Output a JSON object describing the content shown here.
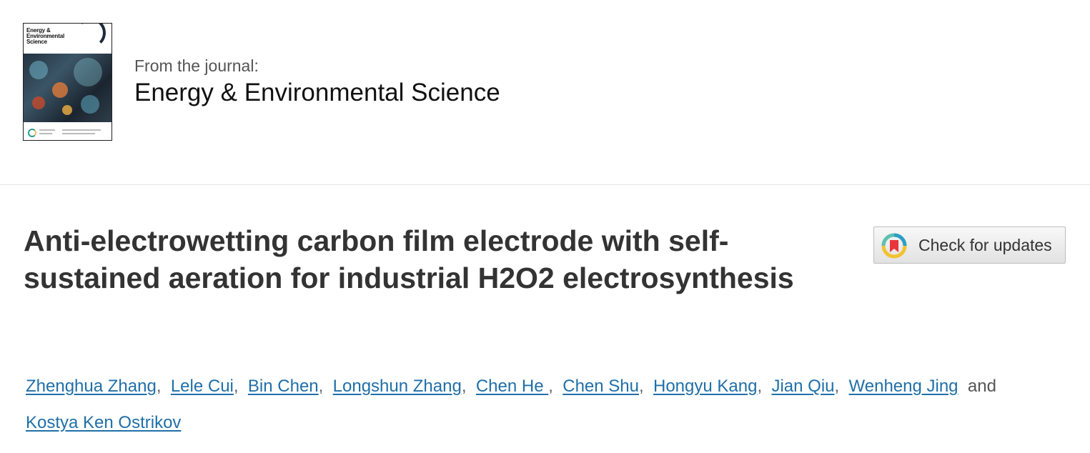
{
  "journal": {
    "cover": {
      "title_line1": "Energy &",
      "title_line2": "Environmental",
      "title_line3": "Science"
    },
    "from_label": "From the journal:",
    "name": "Energy & Environmental Science"
  },
  "article": {
    "title": "Anti-electrowetting carbon film electrode with self-sustained aeration for industrial H2O2 electrosynthesis"
  },
  "updates_button": {
    "label": "Check for updates",
    "icon": "check-for-updates-icon"
  },
  "authors": {
    "list": [
      "Zhenghua Zhang",
      "Lele Cui",
      "Bin Chen",
      "Longshun Zhang",
      "Chen He ",
      "Chen Shu",
      "Hongyu Kang",
      "Jian Qiu",
      "Wenheng Jing",
      "Kostya Ken Ostrikov"
    ],
    "separator": ",",
    "conjunction": "and"
  },
  "colors": {
    "link": "#1f6fa8",
    "title": "#333333",
    "divider": "#e4e4e4"
  }
}
